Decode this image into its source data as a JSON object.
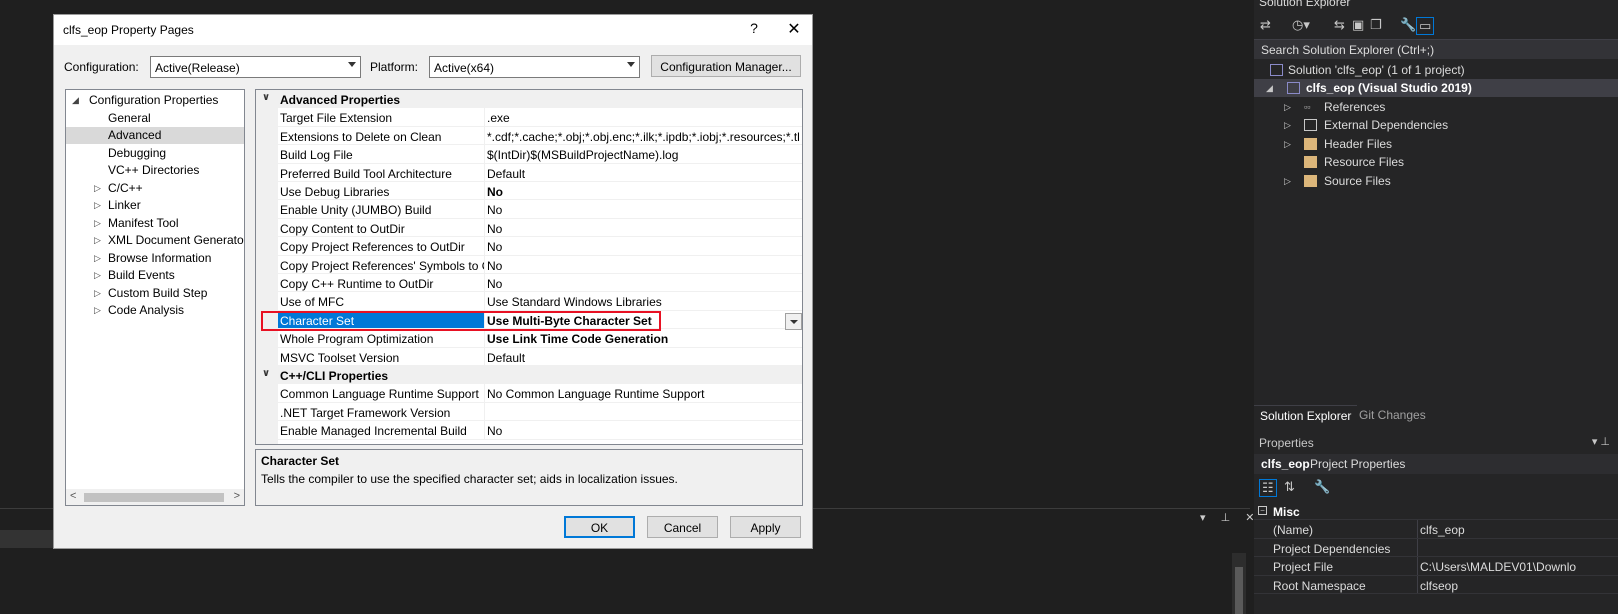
{
  "dialog": {
    "title": "clfs_eop Property Pages",
    "help": "?",
    "close": "✕",
    "configuration_label": "Configuration:",
    "configuration_value": "Active(Release)",
    "platform_label": "Platform:",
    "platform_value": "Active(x64)",
    "config_manager": "Configuration Manager...",
    "ok": "OK",
    "cancel": "Cancel",
    "apply": "Apply"
  },
  "tree": {
    "root": "Configuration Properties",
    "items": [
      "General",
      "Advanced",
      "Debugging",
      "VC++ Directories",
      "C/C++",
      "Linker",
      "Manifest Tool",
      "XML Document Generator",
      "Browse Information",
      "Build Events",
      "Custom Build Step",
      "Code Analysis"
    ]
  },
  "grid": {
    "cat1": "Advanced Properties",
    "rows": [
      {
        "name": "Target File Extension",
        "value": ".exe"
      },
      {
        "name": "Extensions to Delete on Clean",
        "value": "*.cdf;*.cache;*.obj;*.obj.enc;*.ilk;*.ipdb;*.iobj;*.resources;*.tlb;*.tli;*.t"
      },
      {
        "name": "Build Log File",
        "value": "$(IntDir)$(MSBuildProjectName).log"
      },
      {
        "name": "Preferred Build Tool Architecture",
        "value": "Default"
      },
      {
        "name": "Use Debug Libraries",
        "value": "No"
      },
      {
        "name": "Enable Unity (JUMBO) Build",
        "value": "No"
      },
      {
        "name": "Copy Content to OutDir",
        "value": "No"
      },
      {
        "name": "Copy Project References to OutDir",
        "value": "No"
      },
      {
        "name": "Copy Project References' Symbols to OutDir",
        "value": "No"
      },
      {
        "name": "Copy C++ Runtime to OutDir",
        "value": "No"
      },
      {
        "name": "Use of MFC",
        "value": "Use Standard Windows Libraries"
      },
      {
        "name": "Character Set",
        "value": "Use Multi-Byte Character Set"
      },
      {
        "name": "Whole Program Optimization",
        "value": "Use Link Time Code Generation"
      },
      {
        "name": "MSVC Toolset Version",
        "value": "Default"
      }
    ],
    "cat2": "C++/CLI Properties",
    "rows2": [
      {
        "name": "Common Language Runtime Support",
        "value": "No Common Language Runtime Support"
      },
      {
        "name": ".NET Target Framework Version",
        "value": ""
      },
      {
        "name": "Enable Managed Incremental Build",
        "value": "No"
      }
    ]
  },
  "description": {
    "title": "Character Set",
    "text": "Tells the compiler to use the specified character set; aids in localization issues."
  },
  "solution_explorer": {
    "title": "Solution Explorer",
    "search_placeholder": "Search Solution Explorer (Ctrl+;)",
    "solution": "Solution 'clfs_eop' (1 of 1 project)",
    "project": "clfs_eop (Visual Studio 2019)",
    "nodes": [
      "References",
      "External Dependencies",
      "Header Files",
      "Resource Files",
      "Source Files"
    ],
    "tab_active": "Solution Explorer",
    "tab_inactive": "Git Changes"
  },
  "properties": {
    "title": "Properties",
    "object_name": "clfs_eop",
    "object_type": "Project Properties",
    "category": "Misc",
    "rows": [
      {
        "name": "(Name)",
        "value": "clfs_eop"
      },
      {
        "name": "Project Dependencies",
        "value": ""
      },
      {
        "name": "Project File",
        "value": "C:\\Users\\MALDEV01\\Downlo"
      },
      {
        "name": "Root Namespace",
        "value": "clfseop"
      }
    ]
  },
  "colors": {
    "selection": "#0078d7",
    "highlight_box": "#e81123",
    "dark_bg": "#1f1f1f"
  }
}
